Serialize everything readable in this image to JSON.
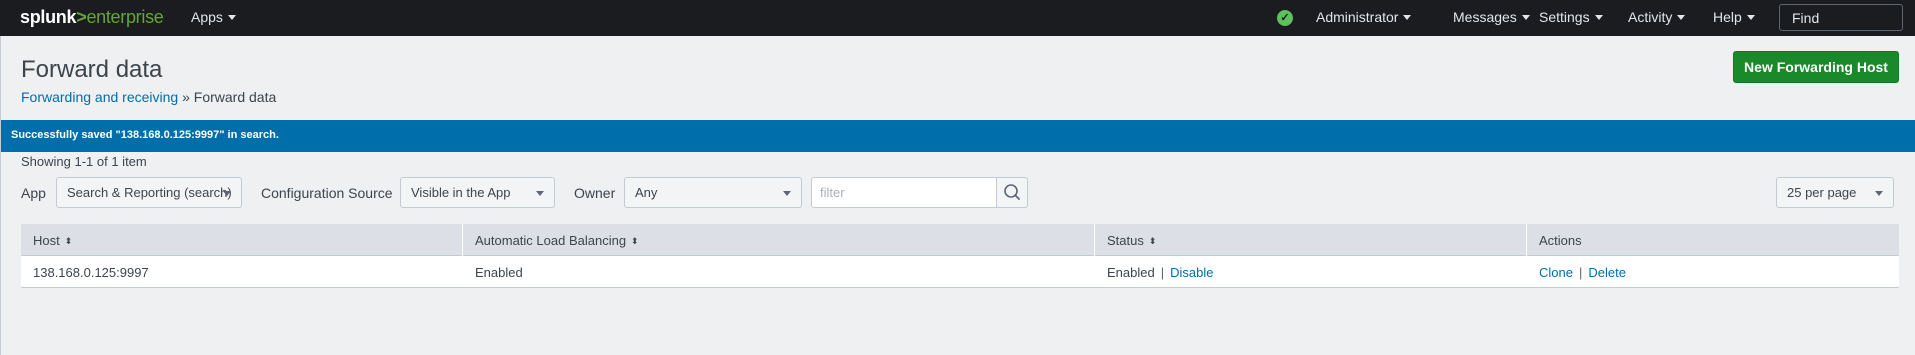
{
  "topbar": {
    "logo_splunk": "splunk",
    "logo_gt": ">",
    "logo_enterprise": "enterprise",
    "apps": "Apps",
    "administrator": "Administrator",
    "messages": "Messages",
    "settings": "Settings",
    "activity": "Activity",
    "help": "Help",
    "find": "Find",
    "status_icon": "check-circle-icon"
  },
  "page": {
    "title": "Forward data",
    "breadcrumb_link": "Forwarding and receiving",
    "breadcrumb_sep": "»",
    "breadcrumb_current": "Forward data",
    "new_button": "New Forwarding Host"
  },
  "banner": {
    "message": "Successfully saved \"138.168.0.125:9997\" in search."
  },
  "listing": {
    "showing": "Showing 1-1 of 1 item"
  },
  "filters": {
    "app_label": "App",
    "app_value": "Search & Reporting (search)",
    "config_label": "Configuration Source",
    "config_value": "Visible in the App",
    "owner_label": "Owner",
    "owner_value": "Any",
    "filter_placeholder": "filter",
    "per_page": "25 per page"
  },
  "table": {
    "headers": [
      "Host",
      "Automatic Load Balancing",
      "Status",
      "Actions"
    ],
    "rows": [
      {
        "host": "138.168.0.125:9997",
        "load_balancing": "Enabled",
        "status": "Enabled",
        "status_action": "Disable",
        "action_clone": "Clone",
        "action_delete": "Delete"
      }
    ]
  },
  "colors": {
    "topbar": "#1a1c20",
    "accent_green": "#65a637",
    "primary_button": "#1a8929",
    "banner": "#006eaa",
    "link": "#006eaa"
  }
}
